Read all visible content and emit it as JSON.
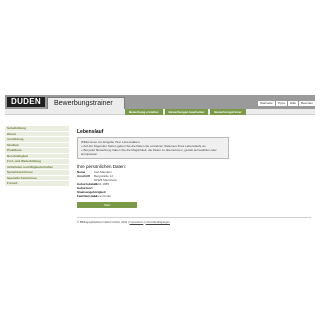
{
  "header": {
    "logo": "DUDEN",
    "title": "Bewerbungstrainer"
  },
  "topnav": [
    "Startseite",
    "Tipps",
    "Hilfe",
    "Beenden"
  ],
  "steps": [
    "Bewerbung erstellen",
    "Bewerbungen bearbeiten",
    "Bewerbungstrainer"
  ],
  "sidebar": {
    "items": [
      "Schulbildung",
      "Dienst",
      "Ausbildung",
      "Studium",
      "Praktikum",
      "Berufstätigkeit",
      "Fort- und Weiterbildung",
      "Aktivitäten und Mitgliedschaften",
      "Sprachkenntnisse",
      "Spezielle Kenntnisse",
      "Freizeit"
    ]
  },
  "main": {
    "title": "Lebenslauf",
    "notice": [
      "Willkommen zur Eingabe Ihrer Lebensdaten:",
      "» Auf der folgenden Seiten geben Sie die Daten der einzelnen Stationen Ihres Lebenslaufs an.",
      "» Bei jeder Bewerbung haben Sie die Möglichkeit, die Daten zu übernehmen, gezielt anzuwählen oder anzupassen."
    ],
    "personal_title": "Ihre persönlichen Daten:",
    "fields": [
      {
        "k": "Name",
        "v": "Karl Mandem"
      },
      {
        "k": "Anschrift",
        "v": "Bergstraße 12"
      },
      {
        "k": "",
        "v": "60325 Mannheim"
      },
      {
        "k": "Geburtsdatum",
        "v": "28.01.1985"
      },
      {
        "k": "Geburtsort",
        "v": ""
      },
      {
        "k": "Staatsangehörigkeit",
        "v": ""
      },
      {
        "k": "Familienstand",
        "v": "Leere Kinder"
      }
    ],
    "start_button": "Start"
  },
  "footer": {
    "copyright": "© Bibliographisches Institut GmbH, 2011 |",
    "link1": "Impressum",
    "sep": "|",
    "link2": "Lizenzbedingungen"
  },
  "colors": {
    "accent_green": "#7a9a48",
    "sidebar_text": "#6a7e3b",
    "header_gray": "#9a9a9a"
  }
}
